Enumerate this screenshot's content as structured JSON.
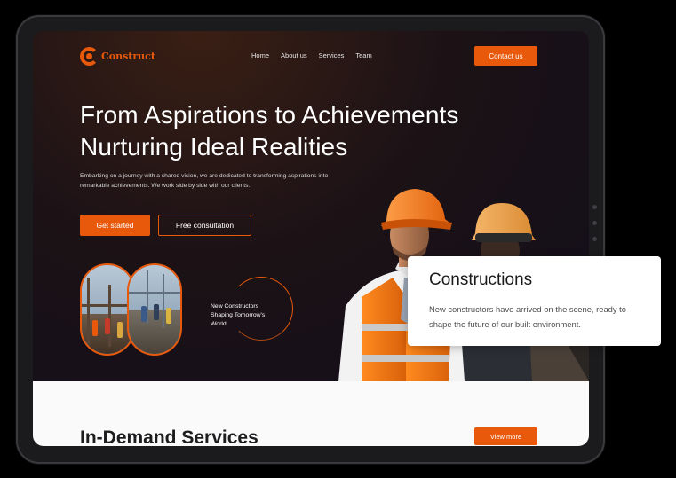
{
  "brand": {
    "name": "Construct",
    "accent": "#e8590c"
  },
  "nav": {
    "items": [
      "Home",
      "About us",
      "Services",
      "Team"
    ],
    "cta": "Contact us"
  },
  "hero": {
    "headline_line1": "From Aspirations to Achievements",
    "headline_line2": "Nurturing Ideal Realities",
    "subtext": "Embarking on a journey with a shared vision, we are dedicated to transforming aspirations into remarkable achievements. We work side by side with our clients.",
    "primary_button": "Get started",
    "secondary_button": "Free consultation",
    "circle_text": "New Constructors Shaping Tomorrow’s World"
  },
  "card": {
    "title": "Constructions",
    "text": "New constructors have arrived on the scene, ready to shape the future of our built environment."
  },
  "services": {
    "title": "In-Demand Services",
    "button": "View more"
  }
}
